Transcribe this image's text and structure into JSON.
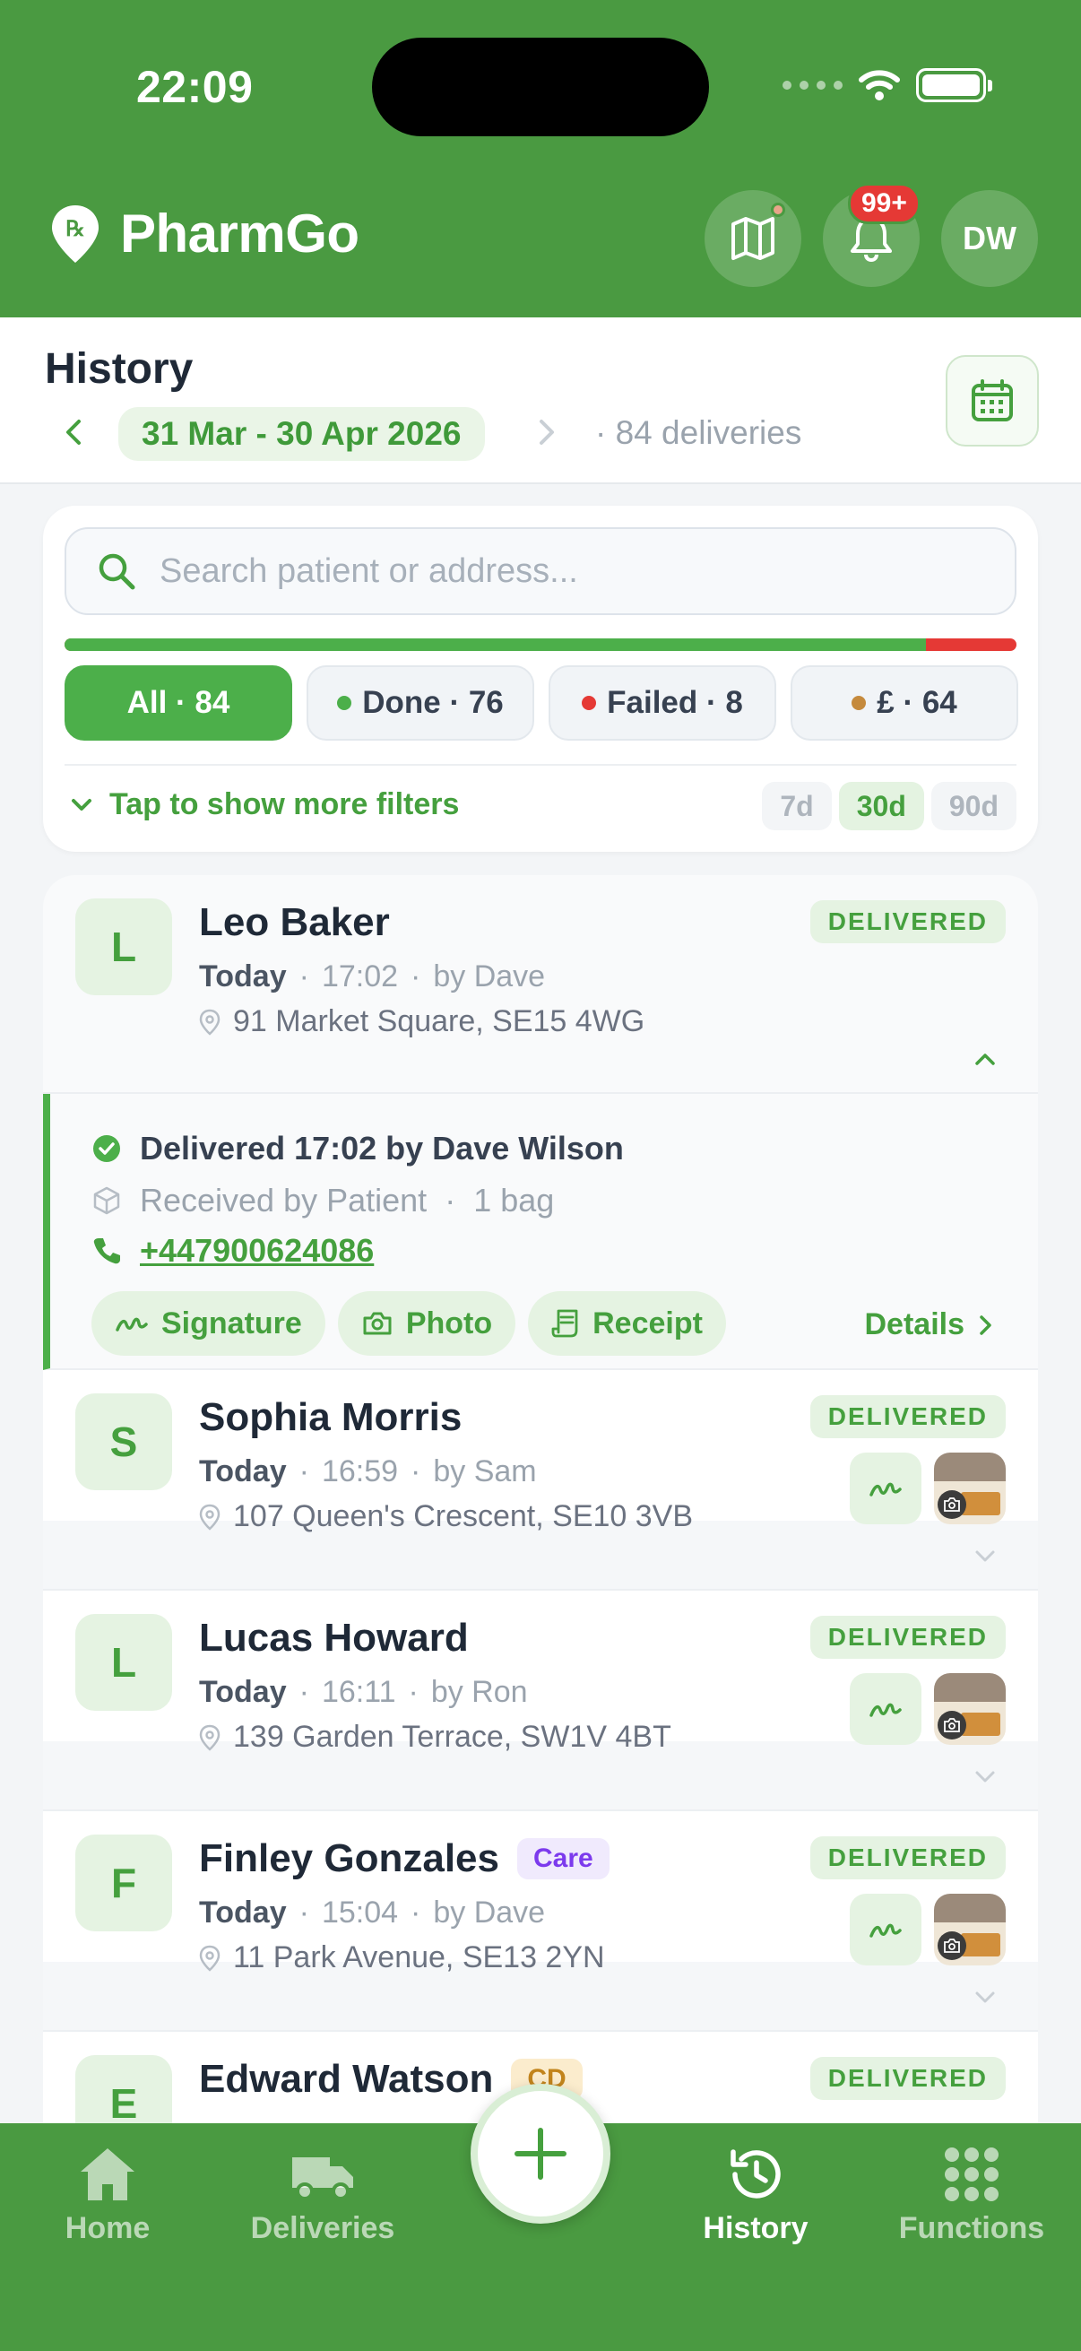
{
  "status_bar": {
    "time": "22:09"
  },
  "header": {
    "app_name": "PharmGo",
    "notifications_badge": "99+",
    "user_initials": "DW",
    "brand_color": "#4a9a41"
  },
  "history": {
    "title": "History",
    "date_range": "31 Mar - 30 Apr 2026",
    "delivery_count": "· 84 deliveries"
  },
  "filters": {
    "search_placeholder": "Search patient or address...",
    "done_ratio": 0.905,
    "chips": [
      {
        "label": "All · 84"
      },
      {
        "label": "Done · 76",
        "dot_color": "#4caf4a"
      },
      {
        "label": "Failed · 8",
        "dot_color": "#e53935"
      },
      {
        "label": "£ · 64",
        "dot_color": "#c58a3d"
      }
    ],
    "more_label": "Tap to show more filters",
    "periods": [
      "7d",
      "30d",
      "90d"
    ],
    "active_period": "30d"
  },
  "deliveries": [
    {
      "initial": "L",
      "name": "Leo Baker",
      "day": "Today",
      "time": "17:02",
      "by": "by Dave",
      "address": "91 Market Square, SE15 4WG",
      "status": "DELIVERED",
      "expanded": true,
      "detail": {
        "delivered_line": "Delivered 17:02 by Dave Wilson",
        "received_by": "Received by Patient",
        "bags": "1 bag",
        "phone": "+447900624086",
        "actions": [
          "Signature",
          "Photo",
          "Receipt"
        ],
        "details_link": "Details"
      }
    },
    {
      "initial": "S",
      "name": "Sophia Morris",
      "day": "Today",
      "time": "16:59",
      "by": "by Sam",
      "address": "107 Queen's Crescent, SE10 3VB",
      "status": "DELIVERED"
    },
    {
      "initial": "L",
      "name": "Lucas Howard",
      "day": "Today",
      "time": "16:11",
      "by": "by Ron",
      "address": "139 Garden Terrace, SW1V 4BT",
      "status": "DELIVERED"
    },
    {
      "initial": "F",
      "name": "Finley Gonzales",
      "tag": "Care",
      "day": "Today",
      "time": "15:04",
      "by": "by Dave",
      "address": "11 Park Avenue, SE13 2YN",
      "status": "DELIVERED"
    },
    {
      "initial": "E",
      "name": "Edward Watson",
      "tag": "CD",
      "status": "DELIVERED"
    }
  ],
  "bottom_nav": {
    "items": [
      {
        "label": "Home",
        "icon": "home-icon"
      },
      {
        "label": "Deliveries",
        "icon": "truck-icon"
      },
      {
        "label": "History",
        "icon": "history-icon",
        "active": true
      },
      {
        "label": "Functions",
        "icon": "grid-icon"
      }
    ],
    "fab_icon": "plus-icon"
  }
}
